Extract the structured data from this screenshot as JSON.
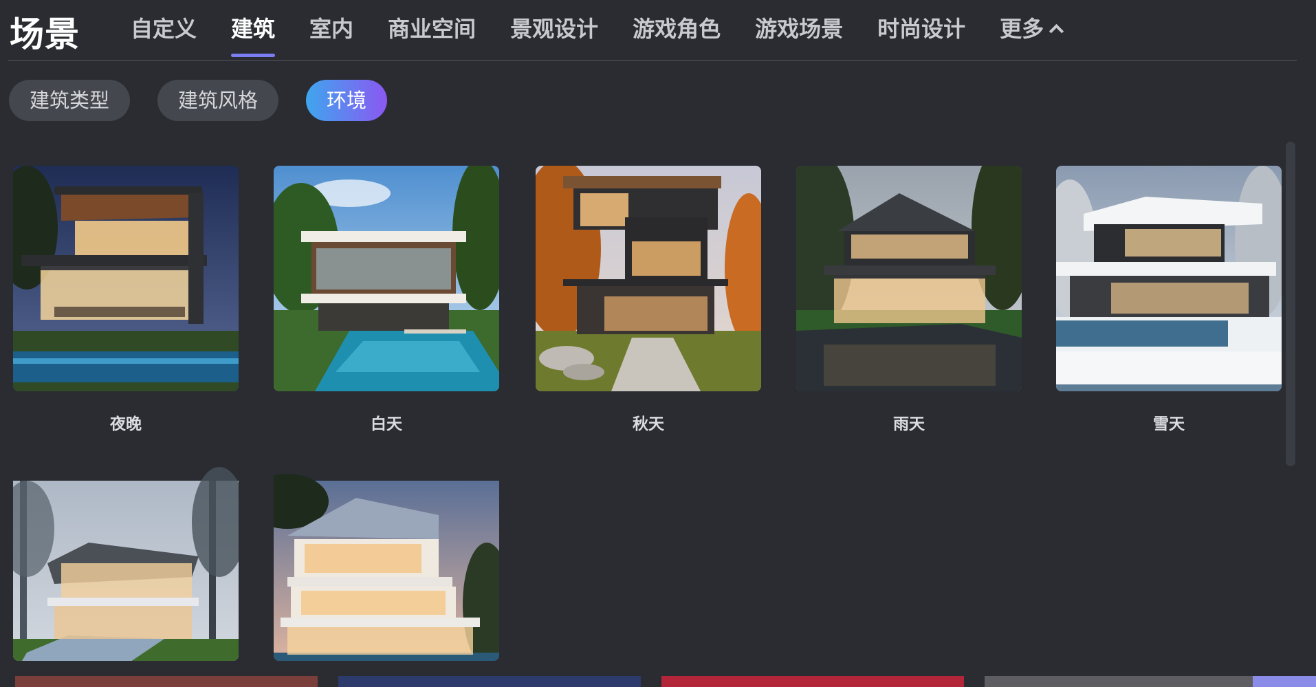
{
  "header": {
    "title": "场景",
    "tabs": [
      {
        "label": "自定义",
        "active": false
      },
      {
        "label": "建筑",
        "active": true
      },
      {
        "label": "室内",
        "active": false
      },
      {
        "label": "商业空间",
        "active": false
      },
      {
        "label": "景观设计",
        "active": false
      },
      {
        "label": "游戏角色",
        "active": false
      },
      {
        "label": "游戏场景",
        "active": false
      },
      {
        "label": "时尚设计",
        "active": false
      }
    ],
    "more_label": "更多"
  },
  "filters": [
    {
      "label": "建筑类型",
      "active": false
    },
    {
      "label": "建筑风格",
      "active": false
    },
    {
      "label": "环境",
      "active": true
    }
  ],
  "cards": [
    {
      "label": "夜晚",
      "theme": "night"
    },
    {
      "label": "白天",
      "theme": "day"
    },
    {
      "label": "秋天",
      "theme": "autumn"
    },
    {
      "label": "雨天",
      "theme": "rain"
    },
    {
      "label": "雪天",
      "theme": "snow"
    },
    {
      "label": "",
      "theme": "fog"
    },
    {
      "label": "",
      "theme": "dusk"
    }
  ],
  "colors": {
    "background": "#2a2c32",
    "accent": "#7b7ef0",
    "pill_gradient_start": "#3fa6ee",
    "pill_gradient_end": "#8a58f2"
  }
}
